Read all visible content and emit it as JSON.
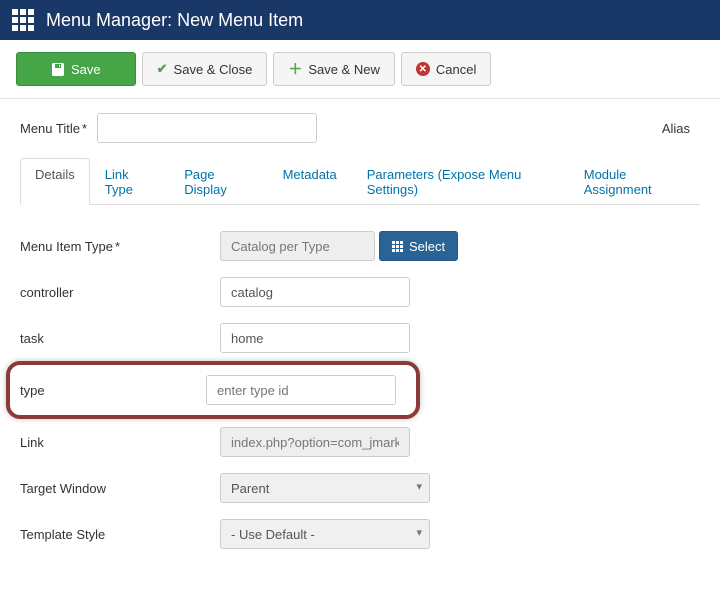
{
  "header": {
    "title": "Menu Manager: New Menu Item"
  },
  "toolbar": {
    "save": "Save",
    "saveClose": "Save & Close",
    "saveNew": "Save & New",
    "cancel": "Cancel"
  },
  "topFields": {
    "menuTitleLabel": "Menu Title",
    "menuTitleValue": "",
    "aliasLabel": "Alias",
    "aliasValue": ""
  },
  "tabs": [
    {
      "label": "Details",
      "active": true
    },
    {
      "label": "Link Type",
      "active": false
    },
    {
      "label": "Page Display",
      "active": false
    },
    {
      "label": "Metadata",
      "active": false
    },
    {
      "label": "Parameters (Expose Menu Settings)",
      "active": false
    },
    {
      "label": "Module Assignment",
      "active": false
    }
  ],
  "fields": {
    "menuItemType": {
      "label": "Menu Item Type",
      "value": "Catalog per Type",
      "selectBtn": "Select"
    },
    "controller": {
      "label": "controller",
      "value": "catalog"
    },
    "task": {
      "label": "task",
      "value": "home"
    },
    "type": {
      "label": "type",
      "placeholder": "enter type id",
      "value": ""
    },
    "link": {
      "label": "Link",
      "value": "index.php?option=com_jmarket&vie"
    },
    "targetWindow": {
      "label": "Target Window",
      "value": "Parent"
    },
    "templateStyle": {
      "label": "Template Style",
      "value": "- Use Default -"
    }
  },
  "requiredMark": "*"
}
